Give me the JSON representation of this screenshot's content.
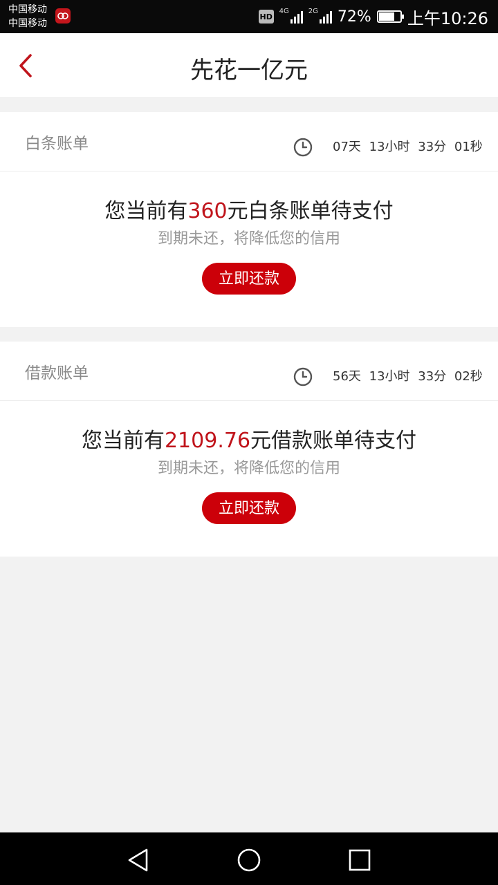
{
  "status_bar": {
    "carrier_1": "中国移动",
    "carrier_2": "中国移动",
    "hd": "HD",
    "network_1": "4G",
    "network_2": "2G",
    "battery_percent": "72%",
    "battery_level": 0.72,
    "time": "上午10:26"
  },
  "header": {
    "title": "先花一亿元"
  },
  "bills": [
    {
      "label": "白条账单",
      "countdown": "07天 13小时 33分 01秒",
      "summary_prefix": "您当前有",
      "amount": "360",
      "summary_suffix": "元白条账单待支付",
      "warning": "到期未还，将降低您的信用",
      "button": "立即还款"
    },
    {
      "label": "借款账单",
      "countdown": "56天 13小时 33分 02秒",
      "summary_prefix": "您当前有",
      "amount": "2109.76",
      "summary_suffix": "元借款账单待支付",
      "warning": "到期未还，将降低您的信用",
      "button": "立即还款"
    }
  ],
  "colors": {
    "accent": "#cc0009",
    "amount": "#c0141b"
  },
  "icons": {
    "back": "chevron-left-icon",
    "clock": "clock-icon",
    "nav_back": "triangle-back-icon",
    "nav_home": "circle-home-icon",
    "nav_recent": "square-recent-icon"
  }
}
